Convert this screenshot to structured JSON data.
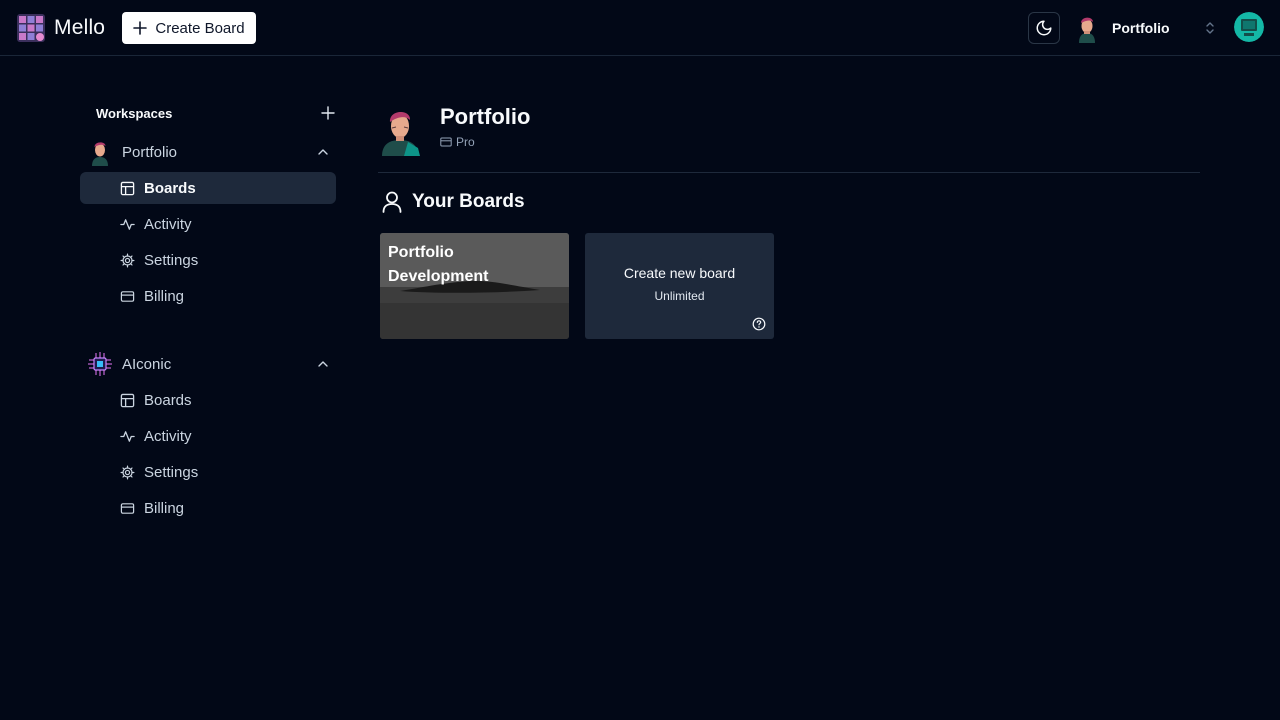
{
  "app": {
    "name": "Mello",
    "create_board_label": "Create Board"
  },
  "header": {
    "org_switcher_name": "Portfolio"
  },
  "sidebar": {
    "workspaces_label": "Workspaces",
    "workspaces": [
      {
        "name": "Portfolio",
        "expanded": true,
        "items": [
          {
            "label": "Boards",
            "icon": "layout-icon",
            "active": true
          },
          {
            "label": "Activity",
            "icon": "activity-icon",
            "active": false
          },
          {
            "label": "Settings",
            "icon": "gear-icon",
            "active": false
          },
          {
            "label": "Billing",
            "icon": "credit-card-icon",
            "active": false
          }
        ]
      },
      {
        "name": "AIconic",
        "expanded": true,
        "items": [
          {
            "label": "Boards",
            "icon": "layout-icon",
            "active": false
          },
          {
            "label": "Activity",
            "icon": "activity-icon",
            "active": false
          },
          {
            "label": "Settings",
            "icon": "gear-icon",
            "active": false
          },
          {
            "label": "Billing",
            "icon": "credit-card-icon",
            "active": false
          }
        ]
      }
    ]
  },
  "main": {
    "org_title": "Portfolio",
    "plan": "Pro",
    "boards_heading": "Your Boards",
    "boards": [
      {
        "title": "Portfolio Development"
      }
    ],
    "new_board": {
      "title": "Create new board",
      "subtitle": "Unlimited"
    }
  },
  "colors": {
    "background": "#020817",
    "active_item": "#1e293b",
    "card": "#1e293b",
    "text": "#f8fafc",
    "muted": "#94a3b8"
  }
}
